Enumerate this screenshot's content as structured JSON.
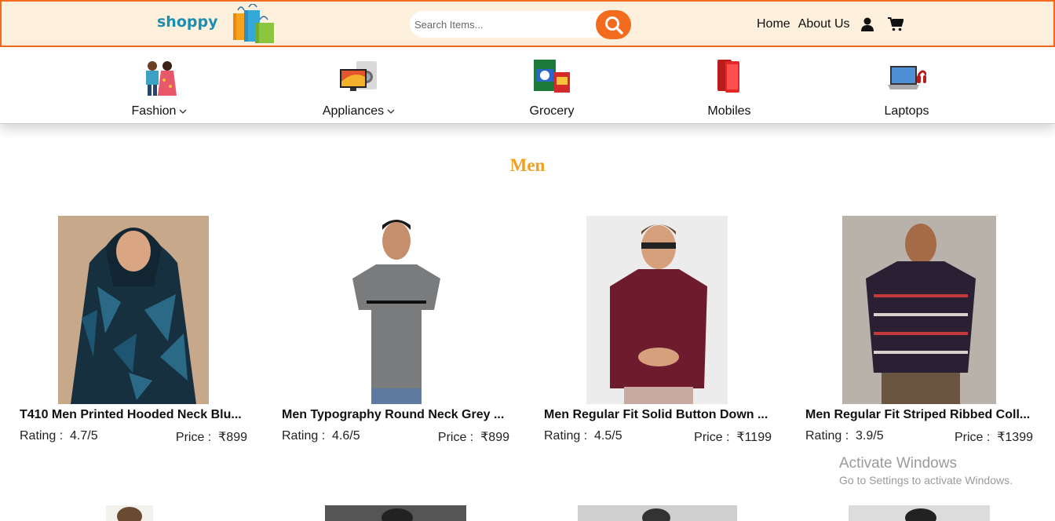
{
  "header": {
    "logo_text": "shoppy",
    "search": {
      "placeholder": "Search Items..."
    },
    "nav": {
      "home": "Home",
      "about": "About Us",
      "user_icon": "user-icon",
      "cart_icon": "cart-icon"
    }
  },
  "categories": [
    {
      "label": "Fashion",
      "has_dropdown": true,
      "icon": "fashion-thumbnail"
    },
    {
      "label": "Appliances",
      "has_dropdown": true,
      "icon": "appliances-thumbnail"
    },
    {
      "label": "Grocery",
      "has_dropdown": false,
      "icon": "grocery-thumbnail"
    },
    {
      "label": "Mobiles",
      "has_dropdown": false,
      "icon": "mobiles-thumbnail"
    },
    {
      "label": "Laptops",
      "has_dropdown": false,
      "icon": "laptops-thumbnail"
    }
  ],
  "section": {
    "title": "Men"
  },
  "products": [
    {
      "name": "T410 Men Printed Hooded Neck Blu...",
      "rating_label": "Rating :",
      "rating": "4.7/5",
      "price_label": "Price :",
      "price": "₹899"
    },
    {
      "name": "Men Typography Round Neck Grey ...",
      "rating_label": "Rating :",
      "rating": "4.6/5",
      "price_label": "Price :",
      "price": "₹899"
    },
    {
      "name": "Men Regular Fit Solid Button Down ...",
      "rating_label": "Rating :",
      "rating": "4.5/5",
      "price_label": "Price :",
      "price": "₹1199"
    },
    {
      "name": "Men Regular Fit Striped Ribbed Coll...",
      "rating_label": "Rating :",
      "rating": "3.9/5",
      "price_label": "Price :",
      "price": "₹1399"
    }
  ],
  "watermark": {
    "line1": "Activate Windows",
    "line2": "Go to Settings to activate Windows."
  },
  "colors": {
    "accent": "#f36b1c",
    "header_bg": "#fdf0dc",
    "section_title": "#f0a020",
    "logo": "#1c8fb0"
  }
}
